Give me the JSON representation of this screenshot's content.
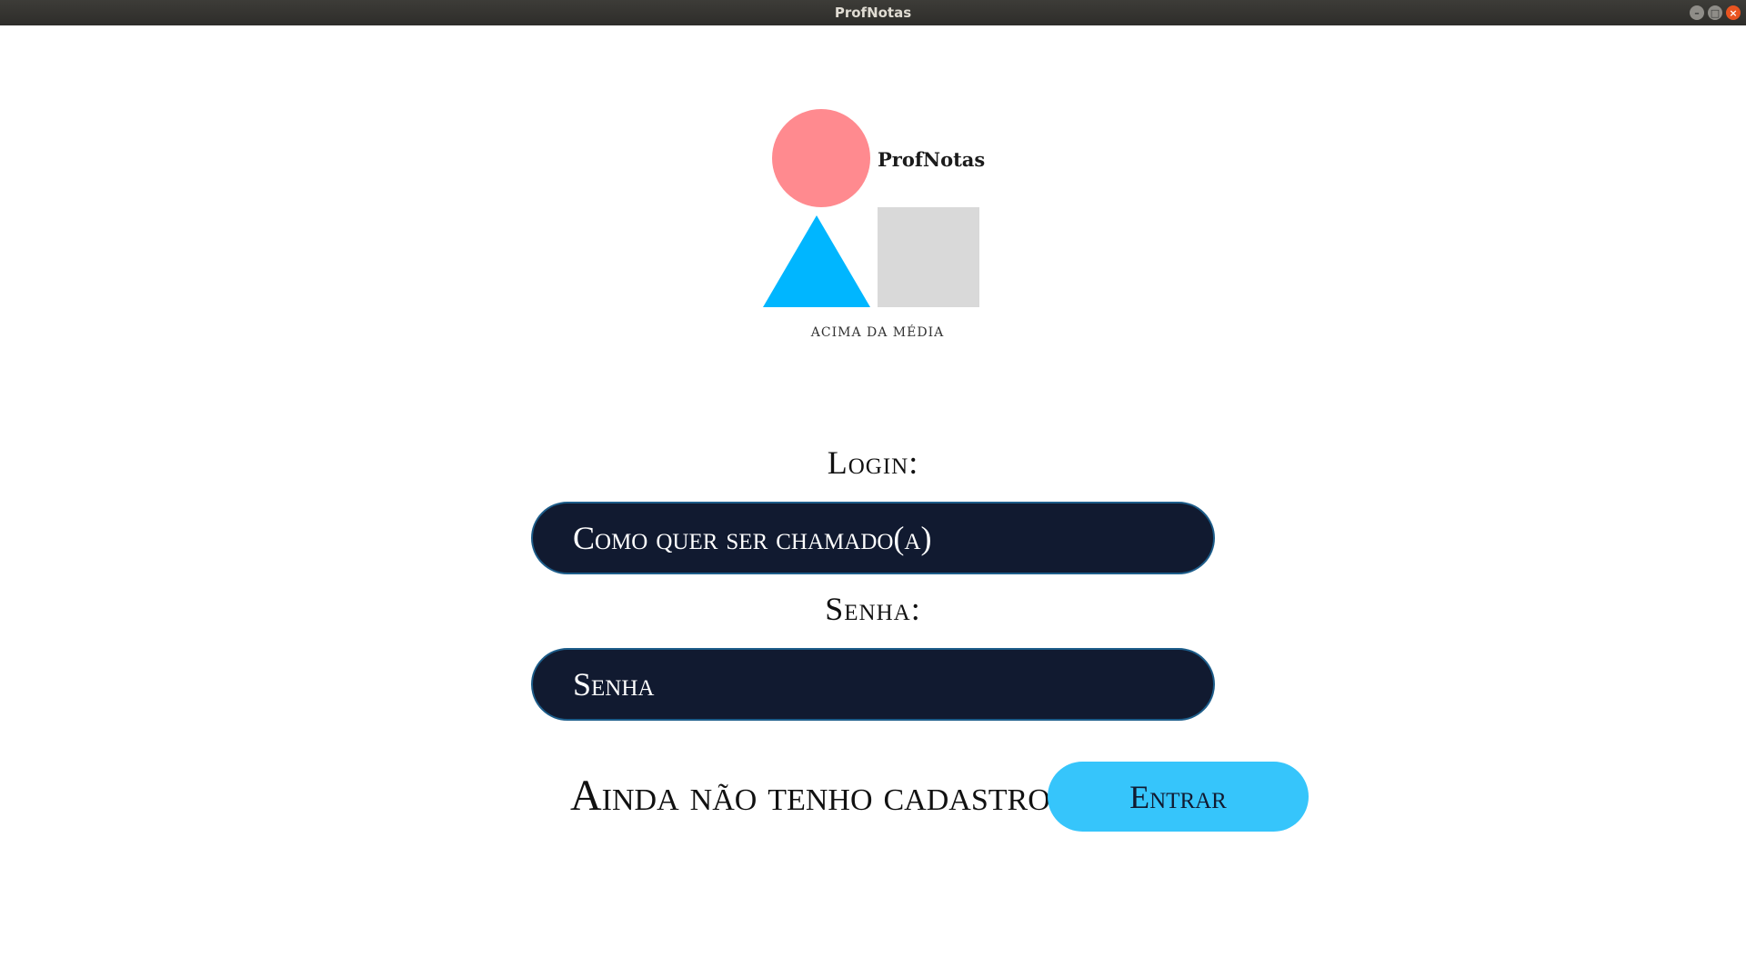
{
  "window": {
    "title": "ProfNotas",
    "controls": {
      "minimize": "–",
      "maximize": "□",
      "close": "×"
    }
  },
  "logo": {
    "name": "ProfNotas",
    "tagline": "ACIMA DA MÉDIA",
    "colors": {
      "circle": "#ff8a8f",
      "triangle": "#00b6ff",
      "square": "#d9d9d9"
    }
  },
  "form": {
    "login_label": "Login:",
    "login_placeholder": "Como quer ser chamado(a)",
    "password_label": "Senha:",
    "password_placeholder": "Senha"
  },
  "actions": {
    "register_link": "Ainda não tenho cadastro",
    "enter_button": "Entrar"
  },
  "colors": {
    "input_bg": "#111a30",
    "button_bg": "#36c5fb"
  }
}
